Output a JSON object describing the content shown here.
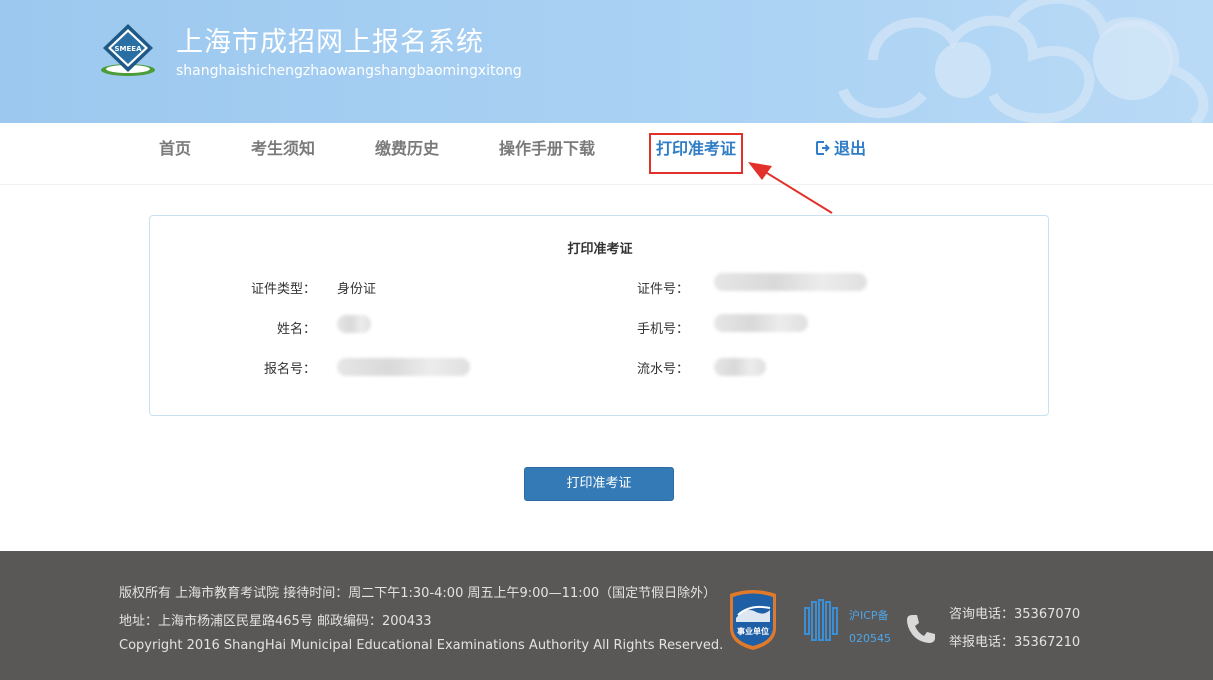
{
  "header": {
    "title": "上海市成招网上报名系统",
    "subtitle": "shanghaishichengzhaowangshangbaomingxitong",
    "logo_text": "SMEEA"
  },
  "nav": {
    "items": [
      {
        "label": "首页"
      },
      {
        "label": "考生须知"
      },
      {
        "label": "缴费历史"
      },
      {
        "label": "操作手册下载"
      },
      {
        "label": "打印准考证"
      },
      {
        "label": "退出"
      }
    ],
    "active_index": 4
  },
  "panel": {
    "title": "打印准考证",
    "fields": {
      "id_type_label": "证件类型：",
      "id_type_value": "身份证",
      "id_number_label": "证件号：",
      "name_label": "姓名：",
      "phone_label": "手机号：",
      "reg_number_label": "报名号：",
      "serial_label": "流水号："
    }
  },
  "actions": {
    "print_label": "打印准考证"
  },
  "footer": {
    "line1": "版权所有    上海市教育考试院 接待时间：周二下午1:30-4:00 周五上午9:00—11:00（国定节假日除外）",
    "line2": "地址：上海市杨浦区民星路465号 邮政编码：200433",
    "line3": "Copyright 2016 ShangHai Municipal Educational Examinations Authority All Rights Reserved.",
    "badge_text": "事业单位",
    "icp_label": "沪ICP备",
    "icp_number": "020545",
    "consult_phone": "咨询电话：35367070",
    "report_phone": "举报电话：35367210"
  },
  "colors": {
    "accent": "#2f7cc7",
    "button": "#337ab7",
    "highlight_border": "#e2312b",
    "footer_bg": "#5a5857"
  }
}
